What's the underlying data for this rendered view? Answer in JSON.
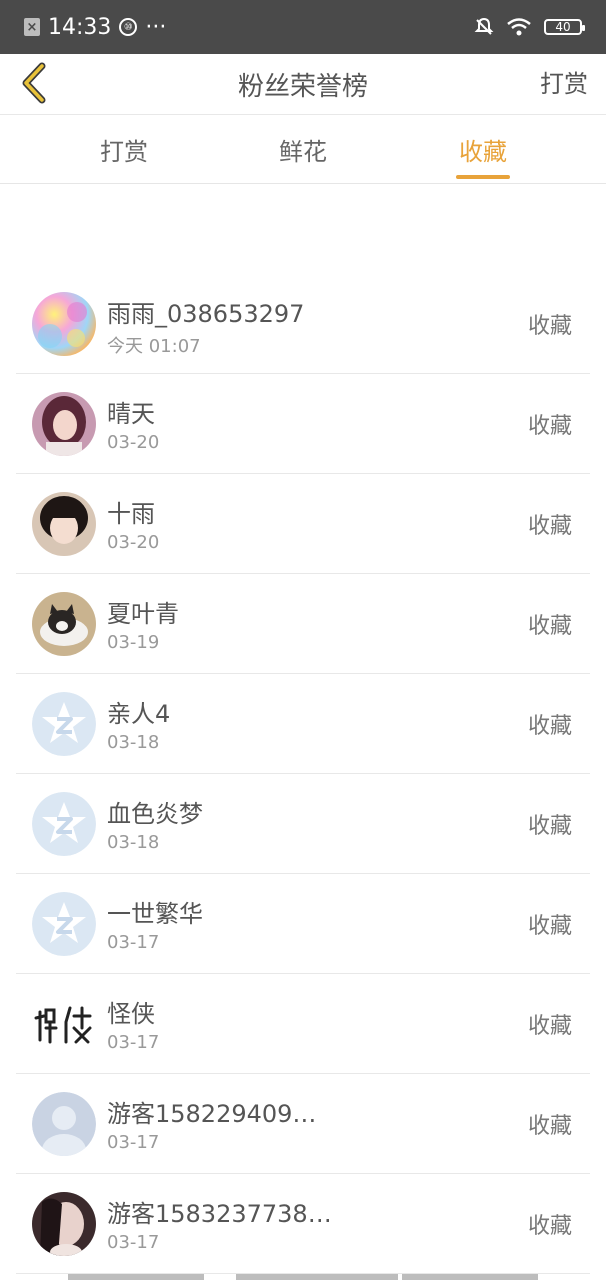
{
  "status_bar": {
    "time": "14:33",
    "dots": "···",
    "battery": "40"
  },
  "nav": {
    "title": "粉丝荣誉榜",
    "right_action": "打赏"
  },
  "tabs": [
    {
      "label": "打赏",
      "active": false
    },
    {
      "label": "鲜花",
      "active": false
    },
    {
      "label": "收藏",
      "active": true
    }
  ],
  "accent_color": "#e8a33a",
  "list": [
    {
      "name": "雨雨_038653297",
      "date": "今天 01:07",
      "action": "收藏",
      "avatar": "colorful-blur"
    },
    {
      "name": "晴天",
      "date": "03-20",
      "action": "收藏",
      "avatar": "girl-photo"
    },
    {
      "name": "十雨",
      "date": "03-20",
      "action": "收藏",
      "avatar": "child-photo"
    },
    {
      "name": "夏叶青",
      "date": "03-19",
      "action": "收藏",
      "avatar": "cat-photo"
    },
    {
      "name": "亲人4",
      "date": "03-18",
      "action": "收藏",
      "avatar": "default-star"
    },
    {
      "name": "血色炎梦",
      "date": "03-18",
      "action": "收藏",
      "avatar": "default-star"
    },
    {
      "name": "一世繁华",
      "date": "03-17",
      "action": "收藏",
      "avatar": "default-star"
    },
    {
      "name": "怪侠",
      "date": "03-17",
      "action": "收藏",
      "avatar": "calligraphy"
    },
    {
      "name": "游客158229409…",
      "date": "03-17",
      "action": "收藏",
      "avatar": "default-person"
    },
    {
      "name": "游客1583237738…",
      "date": "03-17",
      "action": "收藏",
      "avatar": "dark-hair-photo"
    }
  ]
}
